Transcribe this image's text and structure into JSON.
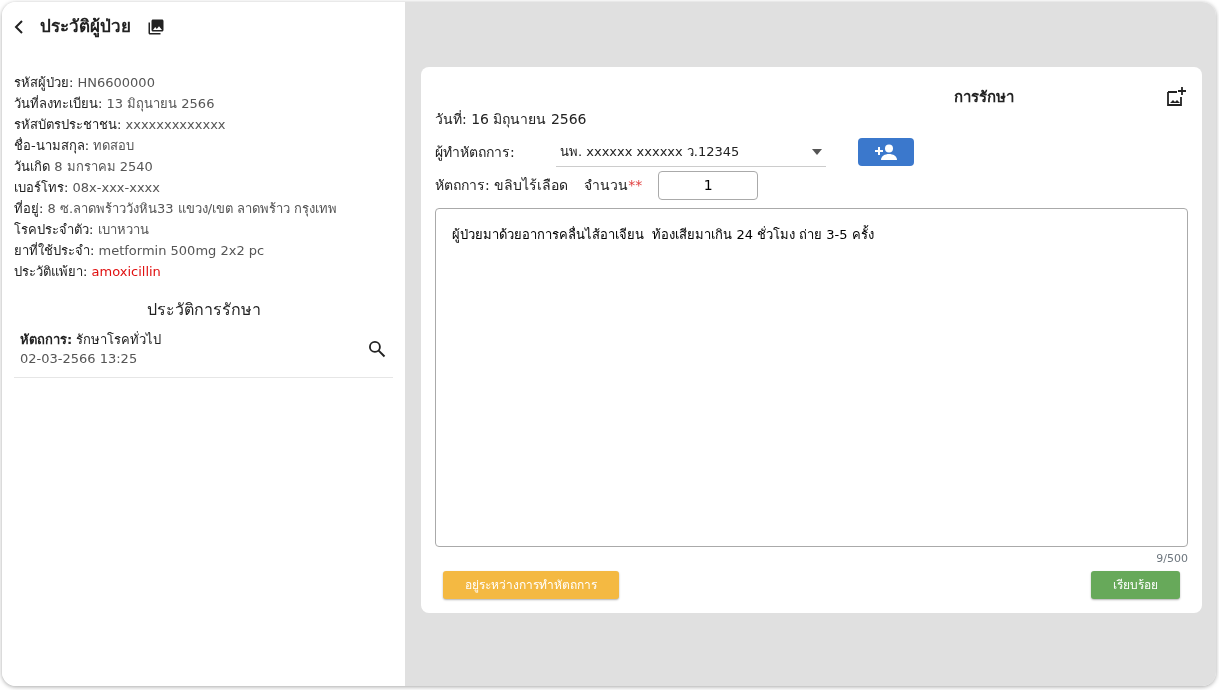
{
  "sidebar": {
    "title": "ประวัติผู้ป่วย",
    "patient_info": [
      {
        "label": "รหัสผู้ป่วย:",
        "value": "HN6600000",
        "alert": false
      },
      {
        "label": "วันที่ลงทะเบียน:",
        "value": "13 มิถุนายน 2566",
        "alert": false
      },
      {
        "label": "รหัสบัตรประชาชน:",
        "value": "xxxxxxxxxxxxx",
        "alert": false
      },
      {
        "label": "ชื่อ-นามสกุล:",
        "value": "ทดสอบ",
        "alert": false
      },
      {
        "label": "วันเกิด",
        "value": "8 มกราคม 2540",
        "alert": false
      },
      {
        "label": "เบอร์โทร:",
        "value": "08x-xxx-xxxx",
        "alert": false
      },
      {
        "label": "ที่อยู่:",
        "value": "8 ซ.ลาดพร้าววังหิน33 แขวง/เขต ลาดพร้าว กรุงเทพ",
        "alert": false
      },
      {
        "label": "โรคประจำตัว:",
        "value": "เบาหวาน",
        "alert": false
      },
      {
        "label": "ยาที่ใช้ประจำ:",
        "value": "metformin 500mg 2x2 pc",
        "alert": false
      },
      {
        "label": "ประวัติแพ้ยา:",
        "value": "amoxicillin",
        "alert": true
      }
    ],
    "history_title": "ประวัติการรักษา",
    "history": [
      {
        "label": "หัตถการ:",
        "procedure": "รักษาโรคทั่วไป",
        "datetime": "02-03-2566 13:25"
      }
    ]
  },
  "treatment": {
    "title": "การรักษา",
    "date": "วันที่: 16 มิถุนายน 2566",
    "operator_label": "ผู้ทำหัตถการ:",
    "operator_value": "นพ. xxxxxx xxxxxx ว.12345",
    "procedure": "หัตถการ: ขลิบไร้เลือด",
    "quantity_label": "จำนวน",
    "required_mark": "**",
    "quantity": "1",
    "notes": "ผู้ป่วยมาด้วยอาการคลื่นไส้อาเจียน  ท้องเสียมาเกิน 24 ชั่วโมง ถ่าย 3-5 ครั้ง",
    "counter": "9/500",
    "buttons": [
      {
        "label": "อยู่ระหว่างการทำหัตถการ",
        "kind": "warning"
      },
      {
        "label": "เรียบร้อย",
        "kind": "success"
      }
    ]
  }
}
